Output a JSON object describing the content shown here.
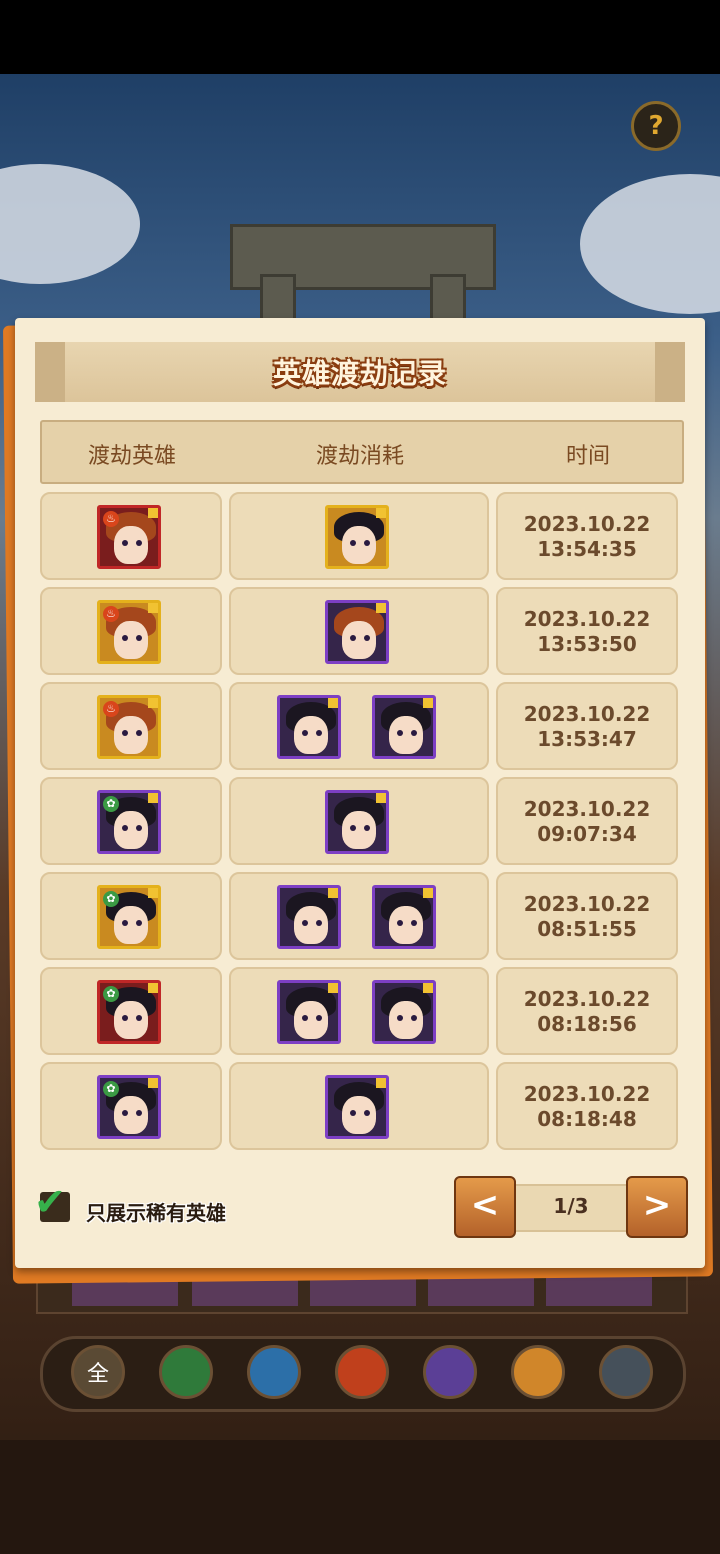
{
  "help_label": "?",
  "panel": {
    "title": "英雄渡劫记录",
    "columns": [
      "渡劫英雄",
      "渡劫消耗",
      "时间"
    ]
  },
  "records": [
    {
      "hero": {
        "name": "lion-hero-portrait",
        "frame": "red",
        "element": "fire"
      },
      "cost": [
        {
          "name": "flower-girl-portrait",
          "frame": "gold"
        }
      ],
      "date": "2023.10.22",
      "time": "13:54:35"
    },
    {
      "hero": {
        "name": "lion-hero-portrait",
        "frame": "gold",
        "element": "fire"
      },
      "cost": [
        {
          "name": "lion-hero-portrait",
          "frame": "purple"
        }
      ],
      "date": "2023.10.22",
      "time": "13:53:50"
    },
    {
      "hero": {
        "name": "lion-hero-portrait",
        "frame": "gold",
        "element": "fire"
      },
      "cost": [
        {
          "name": "dark-hair-girl-portrait",
          "frame": "purple"
        },
        {
          "name": "masked-hero-portrait",
          "frame": "purple"
        }
      ],
      "date": "2023.10.22",
      "time": "13:53:47"
    },
    {
      "hero": {
        "name": "swordsman-portrait",
        "frame": "purple",
        "element": "wood"
      },
      "cost": [
        {
          "name": "swordsman-portrait",
          "frame": "purple"
        }
      ],
      "date": "2023.10.22",
      "time": "09:07:34"
    },
    {
      "hero": {
        "name": "lady-portrait",
        "frame": "gold",
        "element": "wood"
      },
      "cost": [
        {
          "name": "crown-lady-portrait",
          "frame": "purple"
        },
        {
          "name": "green-ribbon-hero-portrait",
          "frame": "purple"
        }
      ],
      "date": "2023.10.22",
      "time": "08:51:55"
    },
    {
      "hero": {
        "name": "blue-hair-girl-portrait",
        "frame": "red",
        "element": "wood"
      },
      "cost": [
        {
          "name": "blue-hair-girl-portrait",
          "frame": "purple"
        },
        {
          "name": "blue-hair-girl-portrait",
          "frame": "purple"
        }
      ],
      "date": "2023.10.22",
      "time": "08:18:56"
    },
    {
      "hero": {
        "name": "blue-hair-girl-portrait",
        "frame": "purple",
        "element": "wood"
      },
      "cost": [
        {
          "name": "blue-hair-girl-portrait",
          "frame": "purple"
        }
      ],
      "date": "2023.10.22",
      "time": "08:18:48"
    }
  ],
  "filter": {
    "label": "只展示稀有英雄",
    "checked": true
  },
  "pager": {
    "prev": "<",
    "next": ">",
    "label": "1/3"
  },
  "element_bar": [
    {
      "name": "all-filter-button",
      "label": "全",
      "color": "#5a4a34"
    },
    {
      "name": "wood-filter-button",
      "label": "",
      "color": "#2f7a3a"
    },
    {
      "name": "water-filter-button",
      "label": "",
      "color": "#2c6fa8"
    },
    {
      "name": "fire-filter-button",
      "label": "",
      "color": "#c0401c"
    },
    {
      "name": "moon-filter-button",
      "label": "",
      "color": "#5b3f96"
    },
    {
      "name": "sun-filter-button",
      "label": "",
      "color": "#d0862a"
    },
    {
      "name": "dark-filter-button",
      "label": "",
      "color": "#45505a"
    }
  ]
}
